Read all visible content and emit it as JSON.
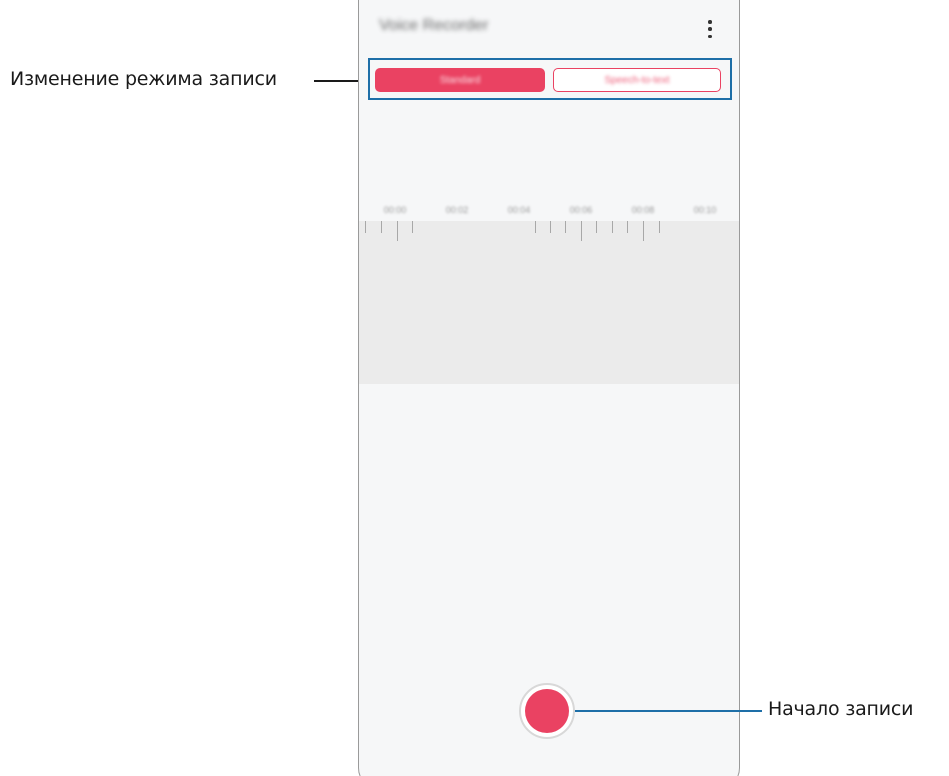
{
  "callouts": {
    "mode_change": "Изменение режима записи",
    "start_record": "Начало записи"
  },
  "app": {
    "title": "Voice Recorder",
    "menu_icon": "more-vert-icon"
  },
  "mode_tabs": [
    {
      "label": "Standard",
      "selected": true
    },
    {
      "label": "Speech-to-text",
      "selected": false
    }
  ],
  "timeline": {
    "labels": [
      "00:00",
      "00:02",
      "00:04",
      "00:06",
      "00:08",
      "00:10"
    ]
  },
  "record_button": {
    "icon": "record-icon"
  },
  "colors": {
    "accent": "#ea4262",
    "callout_line": "#1e6fa8"
  }
}
